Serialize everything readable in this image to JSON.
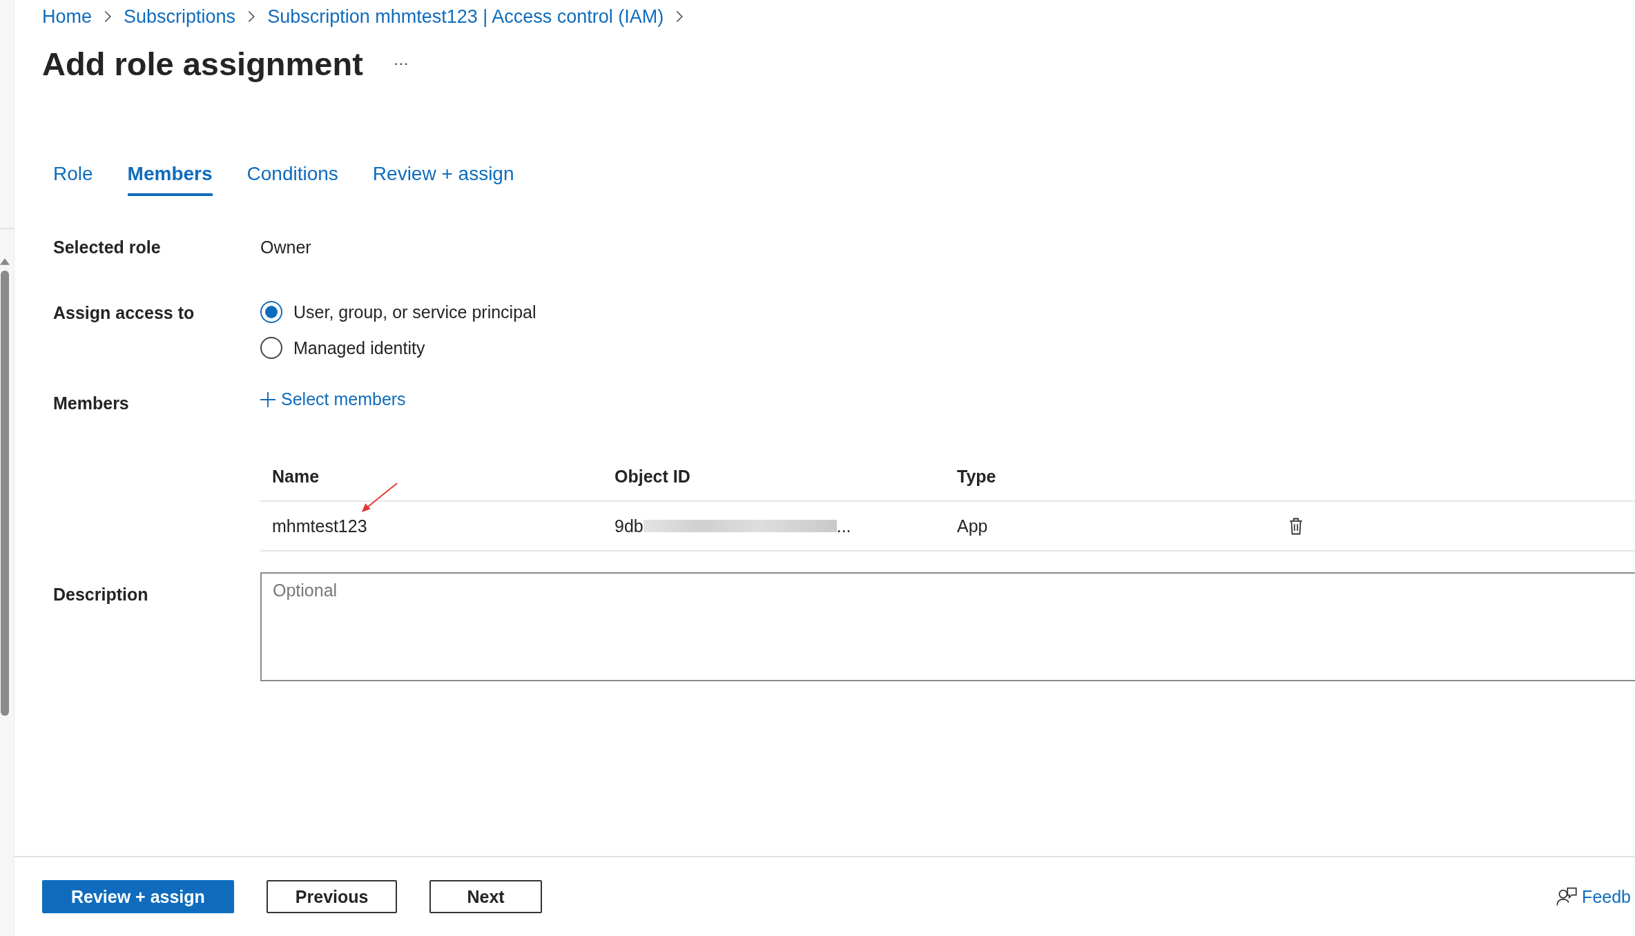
{
  "breadcrumb": [
    "Home",
    "Subscriptions",
    "Subscription mhmtest123 | Access control (IAM)"
  ],
  "title": "Add role assignment",
  "more": "···",
  "tabs": [
    {
      "label": "Role",
      "selected": false
    },
    {
      "label": "Members",
      "selected": true
    },
    {
      "label": "Conditions",
      "selected": false
    },
    {
      "label": "Review + assign",
      "selected": false
    }
  ],
  "selected_role": {
    "label": "Selected role",
    "value": "Owner"
  },
  "assign_access": {
    "label": "Assign access to",
    "options": [
      {
        "label": "User, group, or service principal",
        "selected": true
      },
      {
        "label": "Managed identity",
        "selected": false
      }
    ]
  },
  "members": {
    "label": "Members",
    "action": "Select members"
  },
  "table": {
    "columns": [
      "Name",
      "Object ID",
      "Type"
    ],
    "rows": [
      {
        "name": "mhmtest123",
        "object_id": "9db",
        "object_id_tail": "...",
        "type": "App"
      }
    ]
  },
  "description": {
    "label": "Description",
    "placeholder": "Optional"
  },
  "buttons": [
    {
      "label": "Review + assign",
      "kind": "primary"
    },
    {
      "label": "Previous",
      "kind": "secondary"
    },
    {
      "label": "Next",
      "kind": "secondary"
    }
  ],
  "feedback": "Feedb"
}
